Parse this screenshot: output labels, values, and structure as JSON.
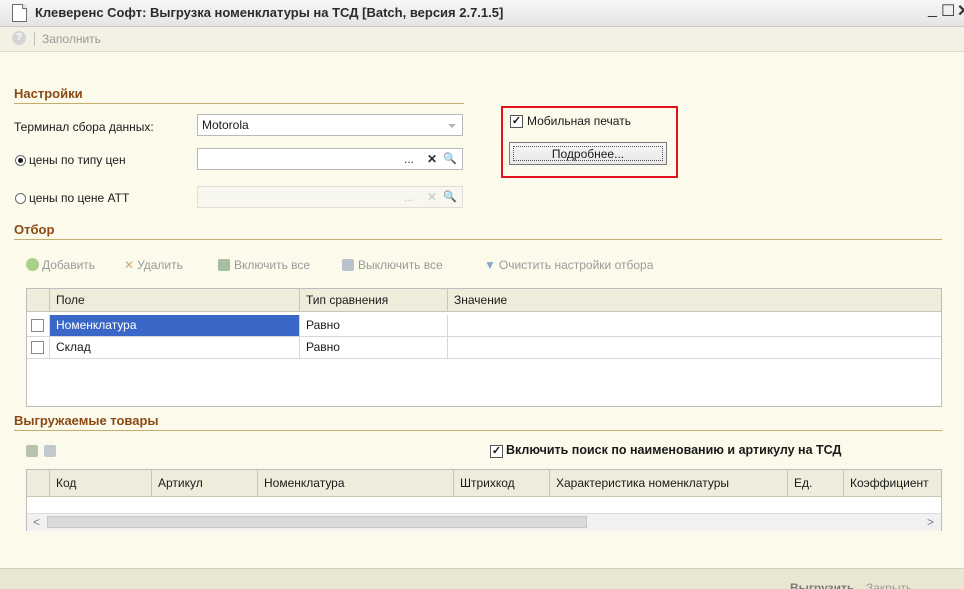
{
  "window": {
    "title": "Клеверенс Софт: Выгрузка номенклатуры на ТСД [Batch, версия 2.7.1.5]",
    "minimize": "_",
    "maximize": "☐",
    "close": "✕"
  },
  "toolbar": {
    "help": "?",
    "fill": "Заполнить"
  },
  "settings": {
    "header": "Настройки",
    "terminal_label": "Терминал сбора данных:",
    "terminal_value": "Motorola",
    "radio_price_type": "цены по типу цен",
    "radio_price_att": "цены по цене АТТ",
    "ellipsis": "...",
    "clear": "✕",
    "search": "🔍",
    "mobile_print_label": "Мобильная печать",
    "mobile_print_checked": true,
    "details_button": "Подробнее..."
  },
  "filter": {
    "header": "Отбор",
    "toolbar": {
      "add": "Добавить",
      "delete": "Удалить",
      "enable_all": "Включить все",
      "disable_all": "Выключить все",
      "clear_settings": "Очистить настройки отбора"
    },
    "columns": [
      "Поле",
      "Тип сравнения",
      "Значение"
    ],
    "rows": [
      {
        "field": "Номенклатура",
        "comparison": "Равно",
        "value": "",
        "checked": false,
        "selected": true
      },
      {
        "field": "Склад",
        "comparison": "Равно",
        "value": "",
        "checked": false,
        "selected": false
      }
    ]
  },
  "goods": {
    "header": "Выгружаемые товары",
    "search_checkbox_label": "Включить поиск по наименованию и артикулу на ТСД",
    "search_checked": true,
    "columns": [
      "Код",
      "Артикул",
      "Номенклатура",
      "Штрихкод",
      "Характеристика номенклатуры",
      "Ед.",
      "Коэффициент"
    ],
    "scroll_left": "<",
    "scroll_right": ">"
  },
  "footer": {
    "export": "Выгрузить",
    "close": "Закрыть"
  },
  "colors": {
    "section_header": "#8b4a14",
    "highlight_border": "#e0131a",
    "selection": "#3a66c8",
    "window_bg": "#fbfaeb"
  }
}
